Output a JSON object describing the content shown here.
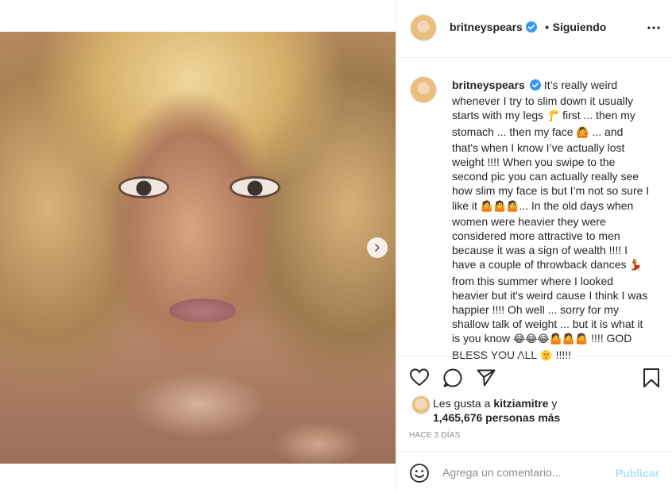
{
  "post": {
    "media_alt": "selfie photo",
    "next_icon": "chevron-right-icon"
  },
  "header": {
    "username": "britneyspears",
    "separator": "•",
    "follow_label": "Siguiendo",
    "more_icon": "more-horizontal-icon"
  },
  "caption": {
    "username": "britneyspears",
    "text_1": "It’s really weird whenever I try to slim down it usually starts with my legs ",
    "emoji_leg": "🦵",
    "text_2": " first ... then my stomach ... then my face ",
    "emoji_face": "🙆",
    "text_3": " ... and that's when I know I’ve actually lost weight !!!! When you swipe to the second pic you can actually really see how slim my face is but I’m not so sure I like it ",
    "emoji_shrug": "🤷🤷🤷",
    "text_4": "... In the old days when women were heavier they were considered more attractive to men because it was a sign of wealth !!!! I have a couple of throwback dances ",
    "emoji_dance": "💃",
    "text_5": " from this summer where I looked heavier but it's weird cause I think I was happier !!!! Oh well ... sorry for my shallow talk of weight ... but it is what it is you know ",
    "emoji_laugh": "😂😂😂🤷🤷🤷",
    "text_6": " !!!! GOD BLESS YOU ALL ",
    "emoji_sun": "🌞",
    "text_7": " !!!!!"
  },
  "likes": {
    "prefix": "Les gusta a ",
    "user": "kitziamitre",
    "connector": " y",
    "count": "1,465,676",
    "suffix": " personas más"
  },
  "timestamp": "HACE 3 DÍAS",
  "comment": {
    "placeholder": "Agrega un comentario...",
    "publish_label": "Publicar"
  },
  "colors": {
    "verified": "#3897f0",
    "publish_disabled": "#b2dffc"
  }
}
